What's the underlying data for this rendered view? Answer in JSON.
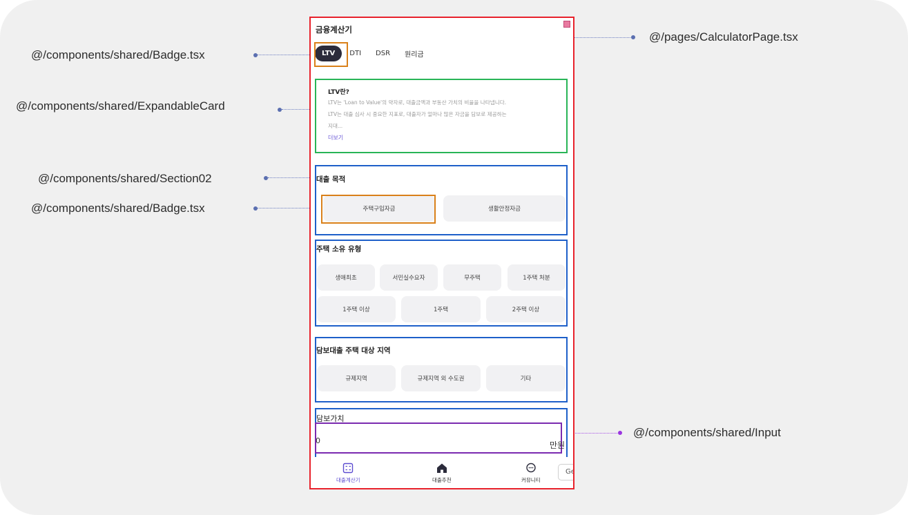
{
  "app": {
    "title": "금융계산기"
  },
  "tabs": [
    "LTV",
    "DTI",
    "DSR",
    "원리금"
  ],
  "card": {
    "title": "LTV란?",
    "lines": [
      "LTV는 'Loan to Value'의 약자로, 대출금액과 부동산 가치의 비율을 나타냅니다.",
      "LTV는 대출 심사 시 중요한 지표로, 대출자가 얼마나 많은 자금을 담보로 제공하는",
      "지대..."
    ],
    "more": "더보기"
  },
  "purpose": {
    "title": "대출 목적",
    "options": [
      "주택구입자금",
      "생활안정자금"
    ]
  },
  "ownership": {
    "title": "주택 소유 유형",
    "row1": [
      "생애최초",
      "서민실수요자",
      "무주택",
      "1주택 처분"
    ],
    "row2": [
      "1주택 이상",
      "1주택",
      "2주택 이상"
    ]
  },
  "region": {
    "title": "담보대출 주택 대상 지역",
    "options": [
      "규제지역",
      "규제지역 외 수도권",
      "기타"
    ]
  },
  "collateral": {
    "title": "담보가치",
    "value": "0",
    "unit": "만원"
  },
  "nav": [
    {
      "label": "대출계산기",
      "icon": "calculator-icon"
    },
    {
      "label": "대출추천",
      "icon": "home-icon"
    },
    {
      "label": "커뮤니티",
      "icon": "chat-bubble-icon"
    }
  ],
  "ge_button": "Ge",
  "annotations": {
    "badge_tabs": "@/components/shared/Badge.tsx",
    "expandable_card": "@/components/shared/ExpandableCard",
    "section": "@/components/shared/Section02",
    "badge_purpose": "@/components/shared/Badge.tsx",
    "page": "@/pages/CalculatorPage.tsx",
    "input": "@/components/shared/Input"
  },
  "colors": {
    "page_outline": "#e8212b",
    "badge_outline": "#d98019",
    "card_outline": "#28b456",
    "section_outline": "#1d5fc9",
    "input_outline": "#7a2ab0",
    "active_tab": "#2b2b3b",
    "accent": "#5b4bd0"
  }
}
